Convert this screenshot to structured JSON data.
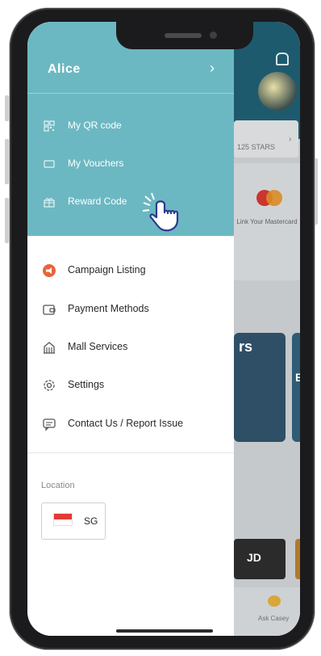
{
  "drawer": {
    "user_name": "Alice",
    "top_items": [
      {
        "label": "My QR code",
        "icon": "qr-code-icon"
      },
      {
        "label": "My Vouchers",
        "icon": "voucher-icon"
      },
      {
        "label": "Reward Code",
        "icon": "gift-icon"
      }
    ],
    "menu_items": [
      {
        "label": "Campaign Listing",
        "icon": "megaphone-icon"
      },
      {
        "label": "Payment Methods",
        "icon": "wallet-icon"
      },
      {
        "label": "Mall Services",
        "icon": "building-icon"
      },
      {
        "label": "Settings",
        "icon": "gear-icon"
      },
      {
        "label": "Contact Us / Report Issue",
        "icon": "chat-icon"
      }
    ],
    "location": {
      "label": "Location",
      "code": "SG",
      "flag": "singapore-flag-icon"
    }
  },
  "background": {
    "stars_text": "125 STARS",
    "card_text": "Link Your Mastercard",
    "promo_text": "rs",
    "jd_text": "JD",
    "ask_text": "Ask Casey"
  },
  "colors": {
    "drawer_header": "#6cb8c2",
    "campaign_icon": "#e8643b",
    "text": "#2a2a2a"
  }
}
